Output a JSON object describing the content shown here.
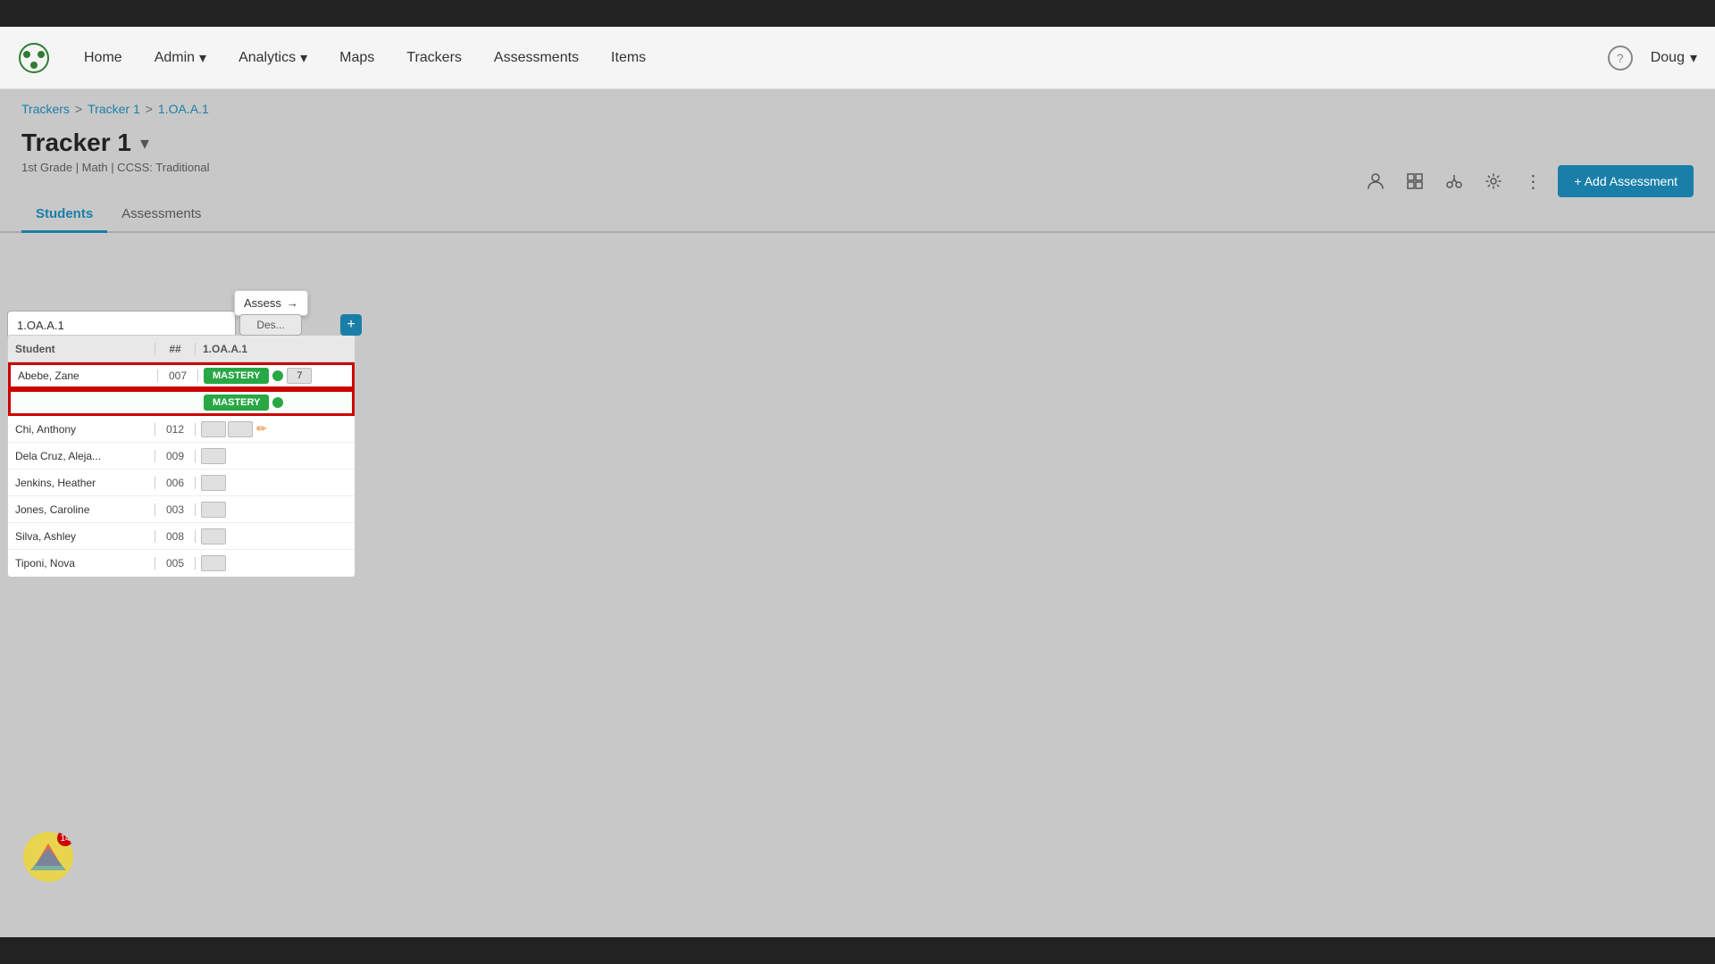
{
  "topbar": {
    "height": 30
  },
  "navbar": {
    "logo_alt": "app-logo",
    "items": [
      {
        "label": "Home",
        "has_dropdown": false
      },
      {
        "label": "Admin",
        "has_dropdown": true
      },
      {
        "label": "Analytics",
        "has_dropdown": true
      },
      {
        "label": "Maps",
        "has_dropdown": false
      },
      {
        "label": "Trackers",
        "has_dropdown": false
      },
      {
        "label": "Assessments",
        "has_dropdown": false
      },
      {
        "label": "Items",
        "has_dropdown": false
      }
    ],
    "help_label": "?",
    "user_label": "Doug",
    "user_chevron": "▾"
  },
  "breadcrumb": {
    "items": [
      "Trackers",
      "Tracker 1",
      "1.OA.A.1"
    ],
    "separators": [
      ">",
      ">"
    ]
  },
  "page_header": {
    "title": "Tracker 1",
    "chevron": "▾",
    "subtitle": "1st Grade | Math | CCSS: Traditional"
  },
  "toolbar": {
    "add_assessment_label": "+ Add Assessment"
  },
  "tabs": [
    {
      "label": "Students",
      "active": true
    },
    {
      "label": "Assessments",
      "active": false
    }
  ],
  "standard_box": {
    "value": "1.OA.A.1"
  },
  "assess_button": {
    "label": "Assess",
    "icon": "→"
  },
  "des_button": {
    "label": "Des..."
  },
  "plus_button": {
    "label": "+"
  },
  "table": {
    "headers": [
      "Student",
      "##",
      "1.OA.A.1"
    ],
    "rows": [
      {
        "name": "Abebe, Zane",
        "num": "007",
        "mastery": "MASTERY",
        "dot": true,
        "score": "7",
        "highlighted": true
      },
      {
        "name": "",
        "num": "",
        "mastery": "MASTERY",
        "dot": true,
        "score": "",
        "highlighted_green": true
      },
      {
        "name": "Chi, Anthony",
        "num": "012",
        "mastery": "",
        "dot": false,
        "score": "",
        "has_edit": true
      },
      {
        "name": "Dela Cruz, Aleja...",
        "num": "009",
        "mastery": "",
        "dot": false,
        "score": ""
      },
      {
        "name": "Jenkins, Heather",
        "num": "006",
        "mastery": "",
        "dot": false,
        "score": ""
      },
      {
        "name": "Jones, Caroline",
        "num": "003",
        "mastery": "",
        "dot": false,
        "score": ""
      },
      {
        "name": "Silva, Ashley",
        "num": "008",
        "mastery": "",
        "dot": false,
        "score": ""
      },
      {
        "name": "Tiponi, Nova",
        "num": "005",
        "mastery": "",
        "dot": false,
        "score": ""
      }
    ]
  },
  "widget": {
    "badge": "14"
  }
}
